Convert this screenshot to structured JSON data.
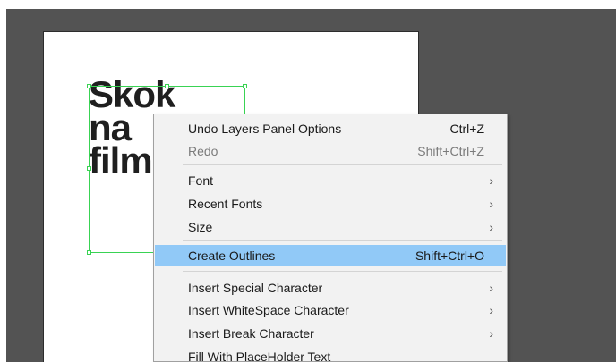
{
  "artboard_text": {
    "lines": [
      "Skok",
      "na",
      "film"
    ]
  },
  "context_menu": {
    "undo": {
      "label": "Undo Layers Panel Options",
      "shortcut": "Ctrl+Z"
    },
    "redo": {
      "label": "Redo",
      "shortcut": "Shift+Ctrl+Z"
    },
    "font": {
      "label": "Font",
      "submenu_icon": "chevron-right-icon"
    },
    "recent_fonts": {
      "label": "Recent Fonts",
      "submenu_icon": "chevron-right-icon"
    },
    "size": {
      "label": "Size",
      "submenu_icon": "chevron-right-icon"
    },
    "create_outlines": {
      "label": "Create Outlines",
      "shortcut": "Shift+Ctrl+O"
    },
    "insert_special": {
      "label": "Insert Special Character",
      "submenu_icon": "chevron-right-icon"
    },
    "insert_whitespace": {
      "label": "Insert WhiteSpace Character",
      "submenu_icon": "chevron-right-icon"
    },
    "insert_break": {
      "label": "Insert Break Character",
      "submenu_icon": "chevron-right-icon"
    },
    "fill_placeholder": {
      "label": "Fill With PlaceHolder Text"
    }
  },
  "colors": {
    "workspace": "#535353",
    "selection": "#39d353",
    "menu_highlight": "#91c9f7"
  }
}
